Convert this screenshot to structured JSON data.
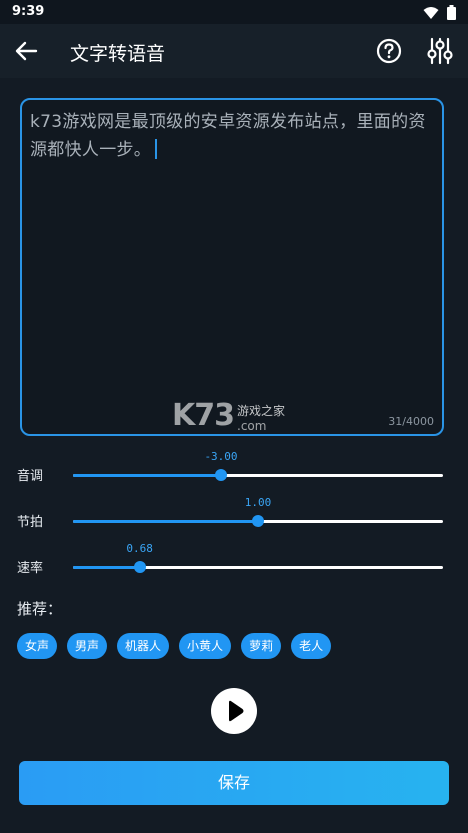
{
  "status_bar": {
    "time": "9:39"
  },
  "app_bar": {
    "title": "文字转语音"
  },
  "editor": {
    "text": "k73游戏网是最顶级的安卓资源发布站点，里面的资源都快人一步。",
    "char_count": "31/4000"
  },
  "watermark": {
    "brand": "K73",
    "cn": "游戏之家",
    "com": ".com"
  },
  "sliders": [
    {
      "label": "音调",
      "value": "-3.00",
      "fraction": 0.4
    },
    {
      "label": "节拍",
      "value": "1.00",
      "fraction": 0.5
    },
    {
      "label": "速率",
      "value": "0.68",
      "fraction": 0.18
    }
  ],
  "recommend": {
    "label": "推荐：",
    "chips": [
      "女声",
      "男声",
      "机器人",
      "小黄人",
      "萝莉",
      "老人"
    ]
  },
  "actions": {
    "save_label": "保存"
  },
  "colors": {
    "accent": "#2196f3",
    "background": "#131b24",
    "app_bar": "#172029"
  }
}
